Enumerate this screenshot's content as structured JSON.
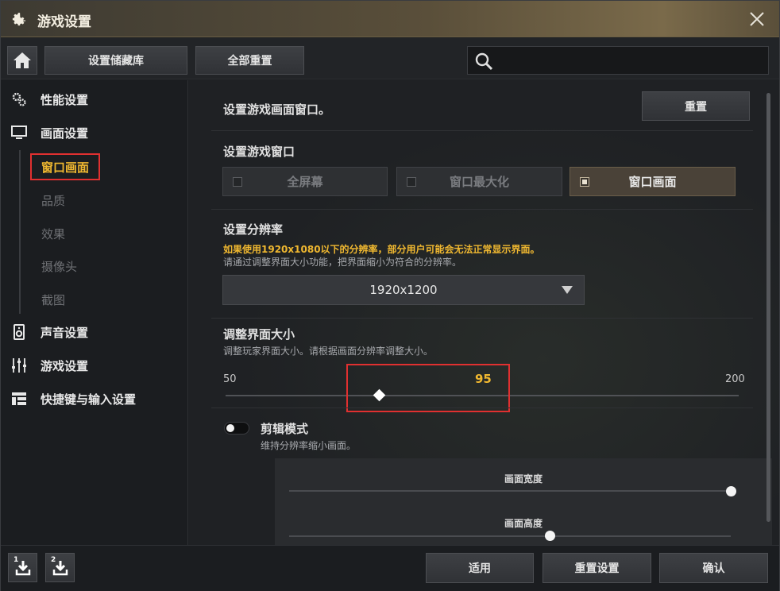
{
  "window": {
    "title": "游戏设置"
  },
  "toolbar": {
    "storage_label": "设置储藏库",
    "reset_all_label": "全部重置",
    "search_placeholder": ""
  },
  "sidebar": {
    "categories": [
      {
        "label": "性能设置",
        "icon": "gears-icon"
      },
      {
        "label": "画面设置",
        "icon": "monitor-icon"
      },
      {
        "label": "声音设置",
        "icon": "speaker-icon"
      },
      {
        "label": "游戏设置",
        "icon": "sliders-icon"
      },
      {
        "label": "快捷键与输入设置",
        "icon": "layout-icon"
      }
    ],
    "sub_items": [
      {
        "label": "窗口画面",
        "active": true
      },
      {
        "label": "品质",
        "active": false
      },
      {
        "label": "效果",
        "active": false
      },
      {
        "label": "摄像头",
        "active": false
      },
      {
        "label": "截图",
        "active": false
      }
    ]
  },
  "main": {
    "window_section_title": "设置游戏画面窗口。",
    "reset_label": "重置",
    "window_mode_title": "设置游戏窗口",
    "window_modes": [
      {
        "label": "全屏幕",
        "selected": false
      },
      {
        "label": "窗口最大化",
        "selected": false
      },
      {
        "label": "窗口画面",
        "selected": true
      }
    ],
    "resolution_title": "设置分辨率",
    "resolution_warning": "如果使用1920x1080以下的分辨率，部分用户可能会无法正常显示界面。",
    "resolution_note": "请通过调整界面大小功能，把界面缩小为符合的分辨率。",
    "resolution_value": "1920x1200",
    "ui_size_title": "调整界面大小",
    "ui_size_note": "调整玩家界面大小。请根据画面分辨率调整大小。",
    "ui_size_min": "50",
    "ui_size_max": "200",
    "ui_size_value": "95",
    "ui_size_numeric": 95,
    "crop_title": "剪辑模式",
    "crop_note": "维持分辨率缩小画面。",
    "crop_enabled": false,
    "screen_width_label": "画面宽度",
    "screen_width_fraction": 1.0,
    "screen_height_label": "画面高度",
    "screen_height_fraction": 0.59
  },
  "footer": {
    "slot1_num": "1",
    "slot2_num": "2",
    "apply_label": "适用",
    "reset_settings_label": "重置设置",
    "confirm_label": "确认"
  },
  "colors": {
    "accent": "#f0b830",
    "highlight_box": "#e03030",
    "titlebar": "#5a4f3a"
  }
}
